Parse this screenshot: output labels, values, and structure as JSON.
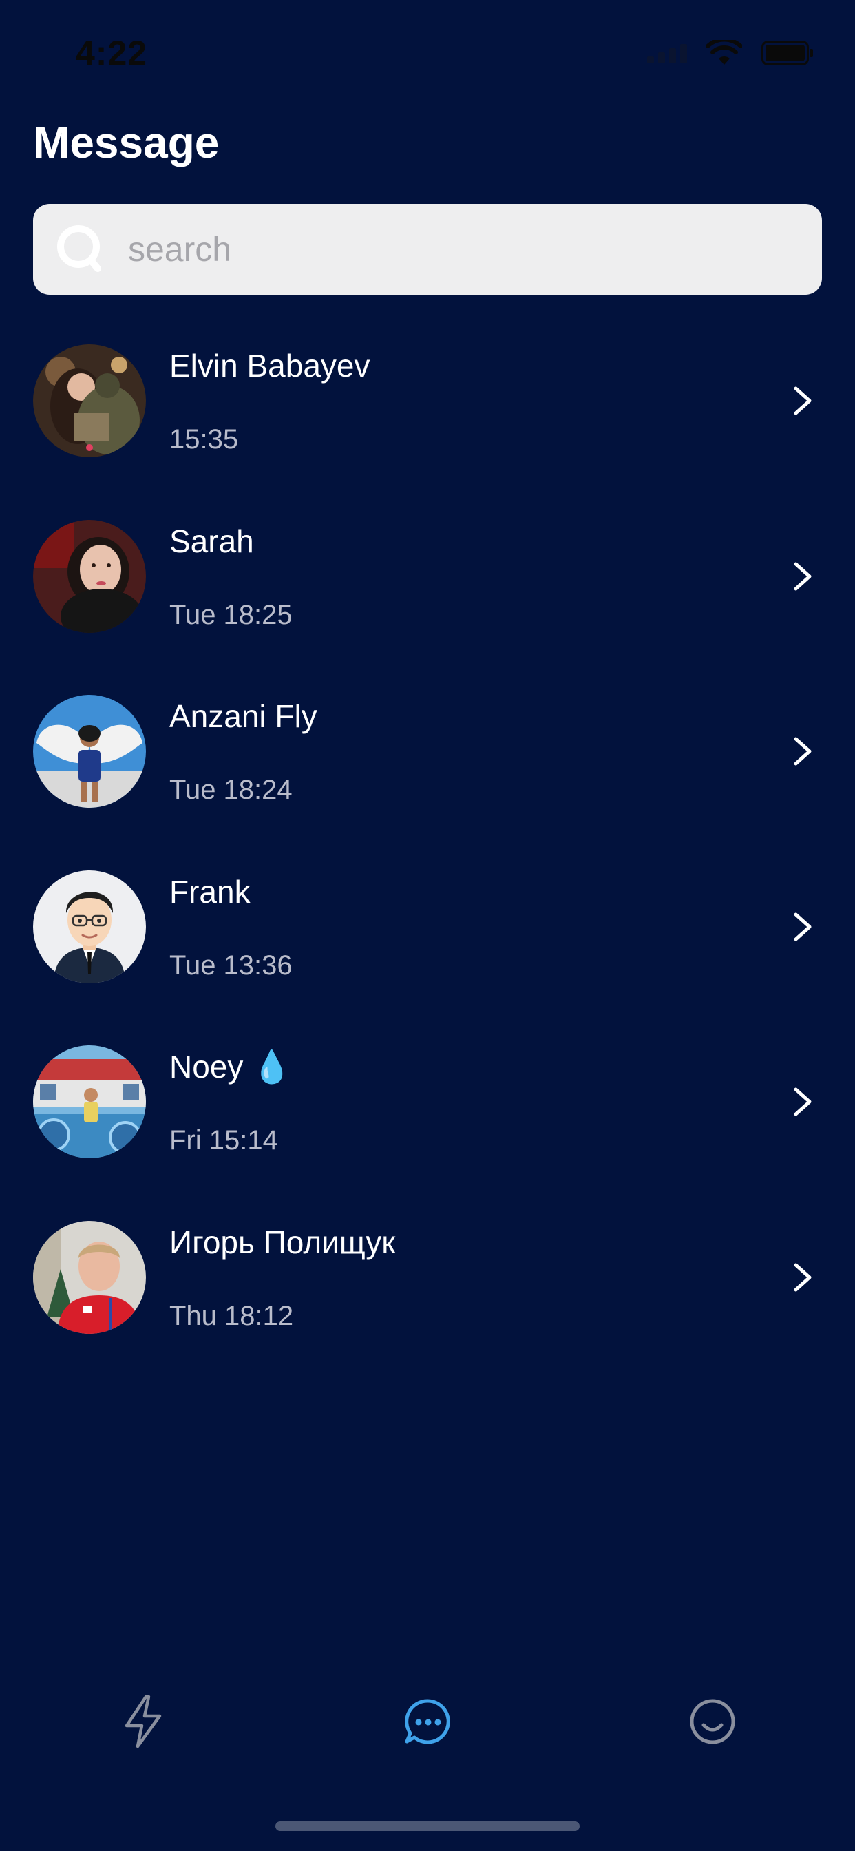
{
  "status_bar": {
    "time": "4:22"
  },
  "header": {
    "title": "Message"
  },
  "search": {
    "placeholder": "search",
    "value": ""
  },
  "contacts": [
    {
      "name": "Elvin Babayev",
      "time": "15:35"
    },
    {
      "name": "Sarah",
      "time": "Tue 18:25"
    },
    {
      "name": "Anzani Fly",
      "time": "Tue 18:24"
    },
    {
      "name": "Frank",
      "time": "Tue 13:36"
    },
    {
      "name": "Noey 💧",
      "time": "Fri 15:14"
    },
    {
      "name": "Игорь Полищук",
      "time": "Thu 18:12"
    }
  ],
  "tab_bar": {
    "tabs": [
      {
        "icon": "lightning-icon",
        "active": false
      },
      {
        "icon": "chat-bubble-icon",
        "active": true
      },
      {
        "icon": "smiley-icon",
        "active": false
      }
    ]
  },
  "colors": {
    "background": "#02123d",
    "accent": "#3fa2ea",
    "inactive_icon": "#8a8f9e",
    "search_bg": "#eeeeef",
    "secondary_text": "#b9bccb"
  }
}
